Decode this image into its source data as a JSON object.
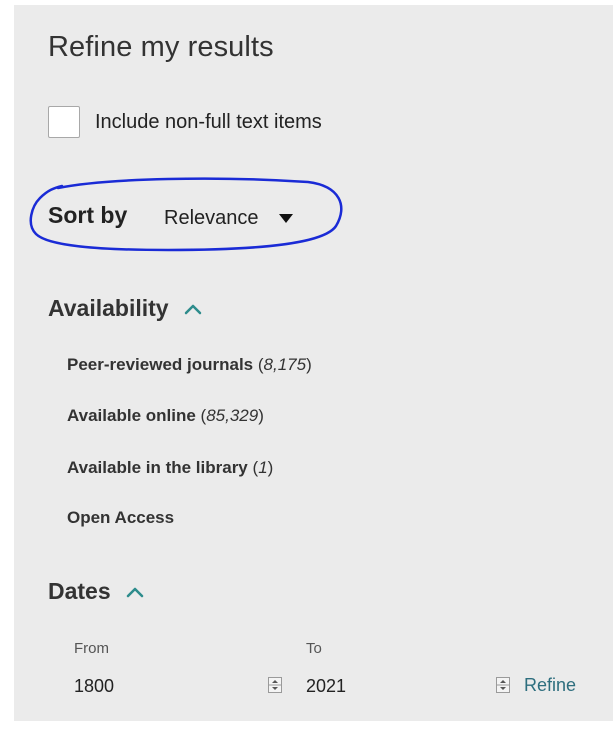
{
  "panel": {
    "title": "Refine my results",
    "include_non_full_text": {
      "label": "Include non-full text items",
      "checked": false
    }
  },
  "sort": {
    "label": "Sort by",
    "selected": "Relevance"
  },
  "annotation": {
    "color": "#1a2bd6"
  },
  "availability": {
    "title": "Availability",
    "facets": [
      {
        "label": "Peer-reviewed journals",
        "count": "8,175"
      },
      {
        "label": "Available online",
        "count": "85,329"
      },
      {
        "label": "Available in the library",
        "count": "1"
      },
      {
        "label": "Open Access",
        "count": ""
      }
    ]
  },
  "dates": {
    "title": "Dates",
    "from_label": "From",
    "from_value": "1800",
    "to_label": "To",
    "to_value": "2021",
    "refine_label": "Refine"
  },
  "colors": {
    "accent": "#2d8c8c",
    "link": "#2d6e7e",
    "panel_bg": "#ebebeb"
  }
}
